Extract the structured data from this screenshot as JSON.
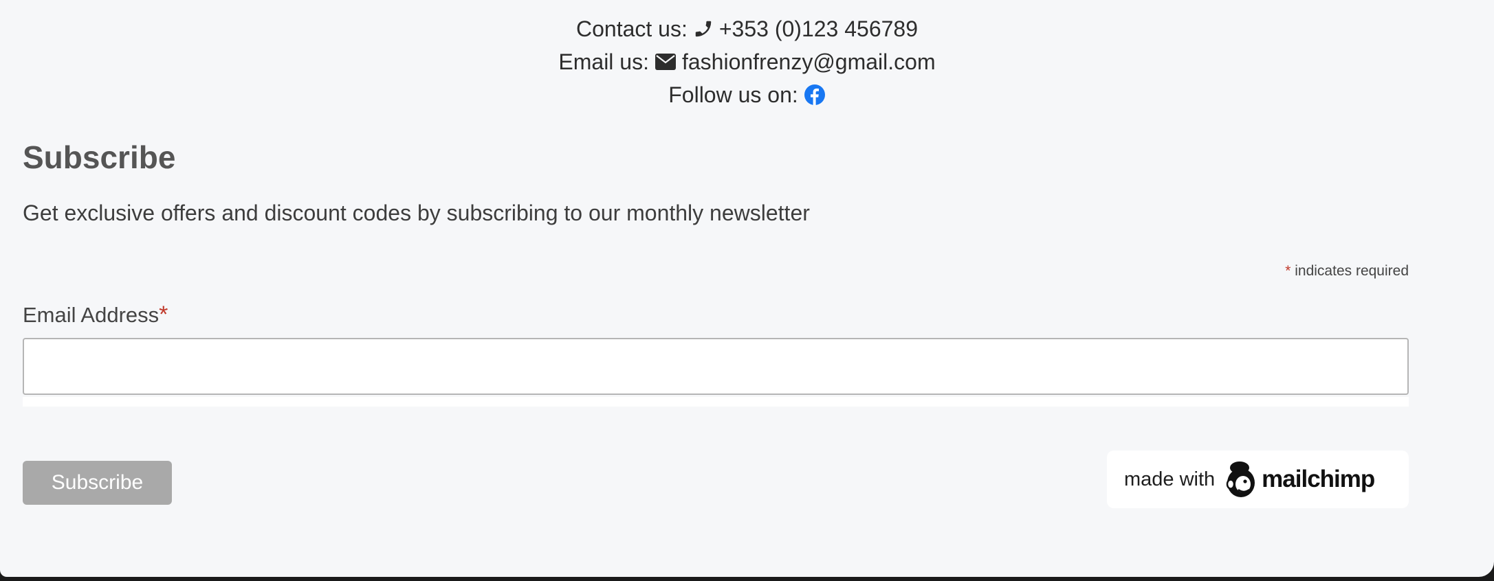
{
  "contact": {
    "phone_label": "Contact us:",
    "phone_icon": "phone-icon",
    "phone": "+353 (0)123 456789",
    "email_label": "Email us:",
    "email_icon": "envelope-icon",
    "email": "fashionfrenzy@gmail.com",
    "follow_label": "Follow us on:",
    "facebook_icon": "facebook-icon",
    "facebook_color": "#1877f2"
  },
  "subscribe": {
    "title": "Subscribe",
    "description": "Get exclusive offers and discount codes by subscribing to our monthly newsletter",
    "required_asterisk": "*",
    "required_note": "indicates required",
    "email_label": "Email Address",
    "email_asterisk": "*",
    "email_value": "",
    "email_placeholder": "",
    "button_label": "Subscribe",
    "button_color": "#a9a9a9",
    "asterisk_color": "#c0392b"
  },
  "badge": {
    "prefix": "made with",
    "brand": "mailchimp",
    "logo_icon": "mailchimp-freddie-icon"
  }
}
